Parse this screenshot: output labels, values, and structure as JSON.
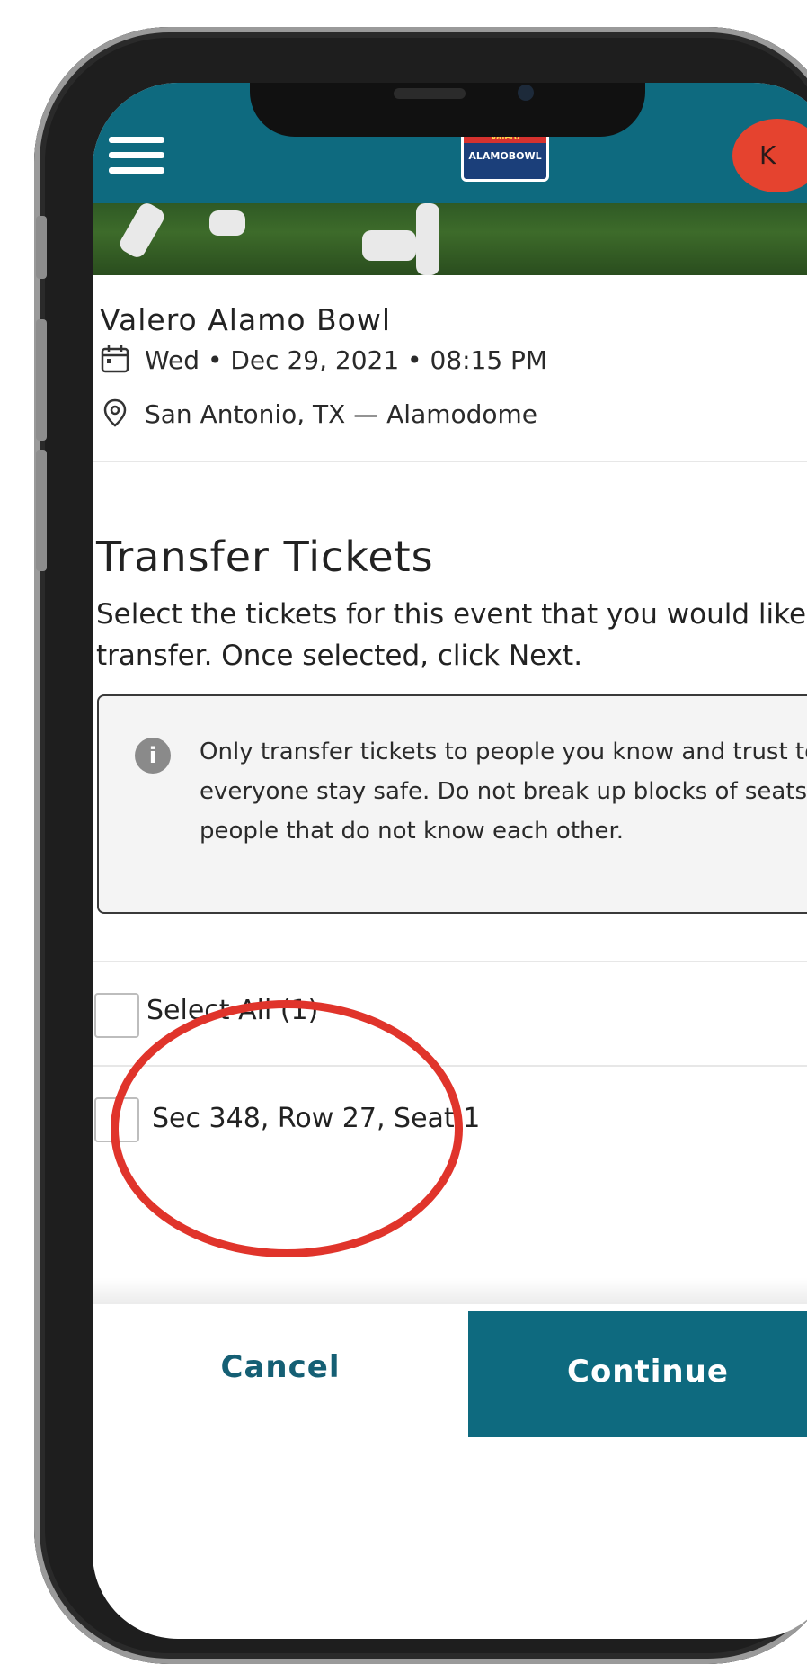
{
  "header": {
    "logo_top": "Valero",
    "logo_main": "ALAMOBOWL",
    "avatar_initial": "K",
    "brand_color": "#0e6a7f"
  },
  "event": {
    "title": "Valero Alamo Bowl",
    "datetime": "Wed • Dec 29, 2021 • 08:15 PM",
    "location": "San Antonio, TX — Alamodome"
  },
  "transfer": {
    "title": "Transfer Tickets",
    "description": "Select the tickets for this event that you would like to transfer. Once selected, click Next.",
    "notice": "Only transfer tickets to people you know and trust to help everyone stay safe. Do not break up blocks of seats for people that do not know each other."
  },
  "selection": {
    "select_all_label": "Select All (1)",
    "select_all_checked": false,
    "tickets": [
      {
        "label": "Sec 348, Row 27, Seat 1",
        "checked": false
      }
    ]
  },
  "actions": {
    "cancel_label": "Cancel",
    "continue_label": "Continue"
  },
  "annotation": {
    "highlight_color": "#e0342b"
  }
}
